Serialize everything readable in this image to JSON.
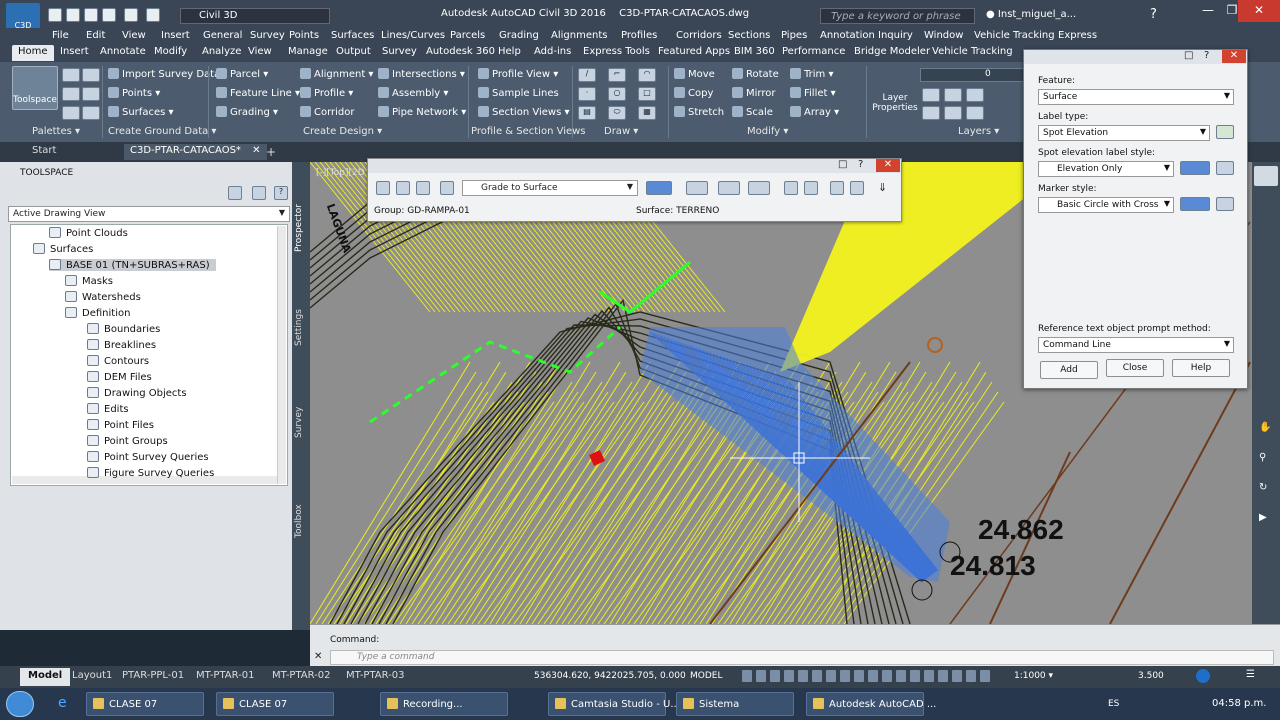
{
  "titlebar": {
    "workspace": "Civil 3D",
    "app_title": "Autodesk AutoCAD Civil 3D 2016",
    "file_name": "C3D-PTAR-CATACAOS.dwg",
    "search_placeholder": "Type a keyword or phrase",
    "user": "Inst_miguel_a...",
    "logo_text": "C3D"
  },
  "menubar": [
    "File",
    "Edit",
    "View",
    "Insert",
    "General",
    "Survey",
    "Points",
    "Surfaces",
    "Lines/Curves",
    "Parcels",
    "Grading",
    "Alignments",
    "Profiles",
    "Corridors",
    "Sections",
    "Pipes",
    "Annotation",
    "Inquiry",
    "Window",
    "Vehicle Tracking",
    "Express"
  ],
  "ribbon_tabs": [
    "Home",
    "Insert",
    "Annotate",
    "Modify",
    "Analyze",
    "View",
    "Manage",
    "Output",
    "Survey",
    "Autodesk 360",
    "Help",
    "Add-ins",
    "Express Tools",
    "Featured Apps",
    "BIM 360",
    "Performance",
    "Bridge Modeler",
    "Vehicle Tracking"
  ],
  "ribbon": {
    "toolspace": "Toolspace",
    "ground": [
      "Import Survey Data",
      "Points",
      "Surfaces"
    ],
    "design": [
      "Parcel",
      "Feature Line",
      "Grading",
      "Alignment",
      "Profile",
      "Corridor",
      "Intersections",
      "Assembly",
      "Pipe Network"
    ],
    "profile": [
      "Profile View",
      "Sample Lines",
      "Section Views"
    ],
    "modify": [
      "Move",
      "Copy",
      "Stretch",
      "Rotate",
      "Mirror",
      "Scale",
      "Trim",
      "Fillet",
      "Array"
    ],
    "layer_properties": "Layer Properties",
    "layer_value": "0",
    "panels": [
      "Palettes",
      "Create Ground Data",
      "Create Design",
      "Profile & Section Views",
      "Draw",
      "Modify",
      "Layers"
    ]
  },
  "doc_tabs": [
    "Start",
    "C3D-PTAR-CATACAOS*"
  ],
  "toolspace": {
    "title": "TOOLSPACE",
    "view_select": "Active Drawing View",
    "items": [
      {
        "label": "Point Clouds",
        "level": 2
      },
      {
        "label": "Surfaces",
        "level": 1
      },
      {
        "label": "BASE 01 (TN+SUBRAS+RAS)",
        "level": 2
      },
      {
        "label": "Masks",
        "level": 3
      },
      {
        "label": "Watersheds",
        "level": 3
      },
      {
        "label": "Definition",
        "level": 3
      },
      {
        "label": "Boundaries",
        "level": 4
      },
      {
        "label": "Breaklines",
        "level": 4
      },
      {
        "label": "Contours",
        "level": 4
      },
      {
        "label": "DEM Files",
        "level": 4
      },
      {
        "label": "Drawing Objects",
        "level": 4
      },
      {
        "label": "Edits",
        "level": 4
      },
      {
        "label": "Point Files",
        "level": 4
      },
      {
        "label": "Point Groups",
        "level": 4
      },
      {
        "label": "Point Survey Queries",
        "level": 4
      },
      {
        "label": "Figure Survey Queries",
        "level": 4
      }
    ],
    "side_tabs": [
      "Prospector",
      "Settings",
      "Survey",
      "Toolbox"
    ]
  },
  "grading_toolbar": {
    "command": "Grade to Surface",
    "group": "Group: GD-RAMPA-01",
    "surface": "Surface: TERRENO"
  },
  "drawing": {
    "elev1": "24.862",
    "elev2": "24.813",
    "view_label": "[-][Top][2D Wireframe]",
    "text_vertical": "LAGUNA"
  },
  "label_dialog": {
    "feature_label": "Feature:",
    "feature": "Surface",
    "label_type_label": "Label type:",
    "label_type": "Spot Elevation",
    "style_label": "Spot elevation label style:",
    "style": "Elevation Only",
    "marker_label": "Marker style:",
    "marker": "Basic Circle with Cross",
    "prompt_label": "Reference text object prompt method:",
    "prompt": "Command Line",
    "add": "Add",
    "close": "Close",
    "help": "Help"
  },
  "command": {
    "history": "Command:",
    "placeholder": "Type a command"
  },
  "layouts": [
    "Model",
    "Layout1",
    "PTAR-PPL-01",
    "MT-PTAR-01",
    "MT-PTAR-02",
    "MT-PTAR-03"
  ],
  "status": {
    "coords": "536304.620, 9422025.705, 0.000",
    "model": "MODEL",
    "scale": "1:1000",
    "value": "3.500"
  },
  "taskbar": {
    "tasks": [
      "CLASE 07",
      "CLASE 07",
      "Recording...",
      "Camtasia Studio - U...",
      "Sistema",
      "Autodesk AutoCAD ..."
    ],
    "lang": "ES",
    "time": "04:58 p.m."
  },
  "colors": {
    "canvas": "#8d8d8d",
    "contours": "#f2f21a",
    "surface_blue": "#3d74d6",
    "accent": "#1e6fc9"
  }
}
